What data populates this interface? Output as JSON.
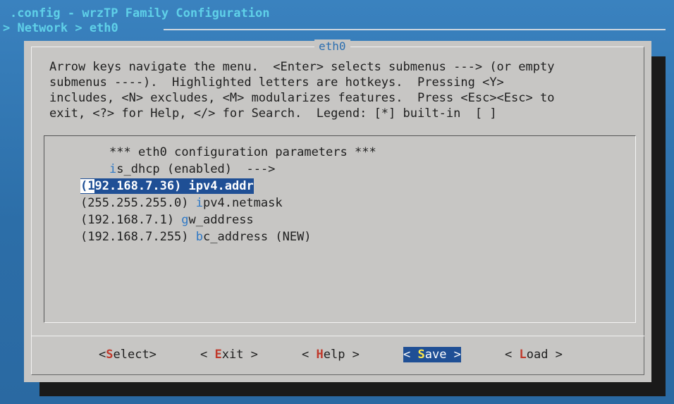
{
  "window": {
    "app_title": ".config - wrzTP Family Configuration",
    "breadcrumb": "> Network > eth0"
  },
  "dialog": {
    "title": "eth0",
    "help_lines": [
      "Arrow keys navigate the menu.  <Enter> selects submenus ---> (or empty",
      "submenus ----).  Highlighted letters are hotkeys.  Pressing <Y>",
      "includes, <N> excludes, <M> modularizes features.  Press <Esc><Esc> to",
      "exit, <?> for Help, </> for Search.  Legend: [*] built-in  [ ]"
    ]
  },
  "menu": {
    "comment": "*** eth0 configuration parameters ***",
    "items": [
      {
        "prefix": "",
        "hotkey": "i",
        "rest": "s_dhcp (enabled)  --->",
        "selected": false
      },
      {
        "prefix": "(192.168.7.36) ",
        "hotkey": "i",
        "rest": "pv4.addr",
        "selected": true
      },
      {
        "prefix": "(255.255.255.0) ",
        "hotkey": "i",
        "rest": "pv4.netmask",
        "selected": false
      },
      {
        "prefix": "(192.168.7.1) ",
        "hotkey": "g",
        "rest": "w_address",
        "selected": false
      },
      {
        "prefix": "(192.168.7.255) ",
        "hotkey": "b",
        "rest": "c_address (NEW)",
        "selected": false
      }
    ]
  },
  "buttons": [
    {
      "pre": "<",
      "hotkey": "S",
      "post": "elect>",
      "active": false
    },
    {
      "pre": "< ",
      "hotkey": "E",
      "post": "xit >",
      "active": false
    },
    {
      "pre": "< ",
      "hotkey": "H",
      "post": "elp >",
      "active": false
    },
    {
      "pre": "< ",
      "hotkey": "S",
      "post": "ave >",
      "active": true
    },
    {
      "pre": "< ",
      "hotkey": "L",
      "post": "oad >",
      "active": false
    }
  ],
  "colors": {
    "background": "#2e6fa8",
    "dialog": "#c7c6c4",
    "highlight": "#1f4f95",
    "hotkey_menu": "#2e78c5",
    "hotkey_button": "#c0392b",
    "title_text": "#5fd0e8"
  }
}
